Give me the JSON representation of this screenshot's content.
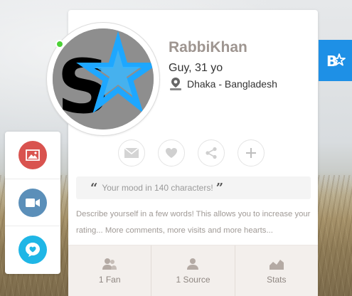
{
  "profile": {
    "username": "RabbiKhan",
    "subtitle": "Guy, 31 yo",
    "location": "Dhaka - Bangladesh",
    "online": true
  },
  "actions": [
    {
      "name": "message",
      "icon": "envelope-icon"
    },
    {
      "name": "like",
      "icon": "heart-icon"
    },
    {
      "name": "share",
      "icon": "share-icon"
    },
    {
      "name": "add",
      "icon": "plus-icon"
    }
  ],
  "mood": {
    "placeholder": "Your mood in 140 characters!"
  },
  "bio": {
    "text": "Describe yourself in a few words! This allows you to increase your rating... More comments, more visits and more hearts..."
  },
  "stats": [
    {
      "label": "1 Fan",
      "icon": "fans-icon"
    },
    {
      "label": "1 Source",
      "icon": "source-icon"
    },
    {
      "label": "Stats",
      "icon": "chart-icon"
    }
  ],
  "sidebar": {
    "items": [
      {
        "name": "photos",
        "icon": "image-icon",
        "color": "#d9534f"
      },
      {
        "name": "videos",
        "icon": "video-camera-icon",
        "color": "#5b8fb9"
      },
      {
        "name": "mood",
        "icon": "heart-bubble-icon",
        "color": "#1fb6e6"
      }
    ]
  },
  "colors": {
    "accent_blue": "#1e90e6",
    "online_green": "#4cd137",
    "username": "#9e9590"
  }
}
